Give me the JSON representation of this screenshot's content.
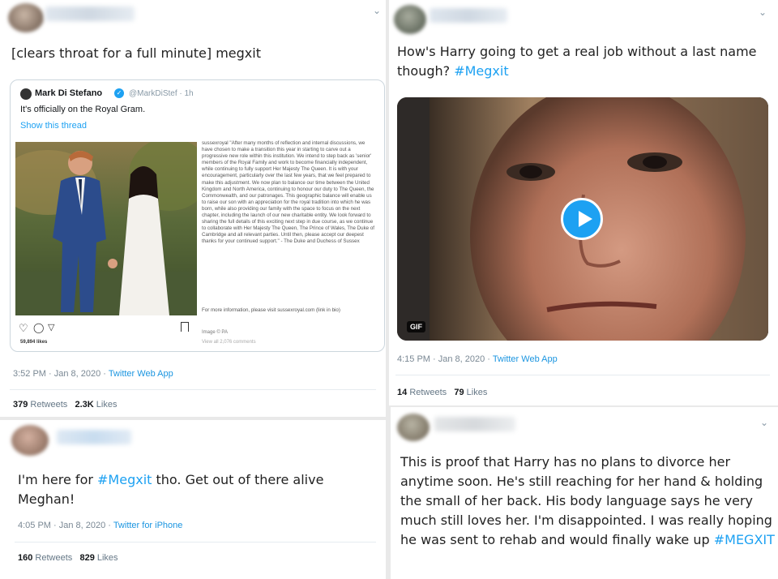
{
  "tweets": [
    {
      "text": "[clears throat for a full minute] megxit",
      "meta": {
        "time": "3:52 PM · Jan 8, 2020 · ",
        "source": "Twitter Web App"
      },
      "stats": {
        "retweets": "379",
        "retweets_label": "Retweets",
        "likes": "2.3K",
        "likes_label": "Likes"
      },
      "embed": {
        "name": "Mark Di Stefano",
        "handle": "@MarkDiStef · 1h",
        "text": "It's officially on the Royal Gram.",
        "link": "Show this thread",
        "caption": "sussexroyal \"After many months of reflection and internal discussions, we have chosen to make a transition this year in starting to carve out a progressive new role within this institution. We intend to step back as 'senior' members of the Royal Family and work to become financially independent, while continuing to fully support Her Majesty The Queen. It is with your encouragement, particularly over the last few years, that we feel prepared to make this adjustment. We now plan to balance our time between the United Kingdom and North America, continuing to honour our duty to The Queen, the Commonwealth, and our patronages. This geographic balance will enable us to raise our son with an appreciation for the royal tradition into which he was born, while also providing our family with the space to focus on the next chapter, including the launch of our new charitable entity. We look forward to sharing the full details of this exciting next step in due course, as we continue to collaborate with Her Majesty The Queen, The Prince of Wales, The Duke of Cambridge and all relevant parties. Until then, please accept our deepest thanks for your continued support.\" - The Duke and Duchess of Sussex",
        "more_info": "For more information, please visit sussexroyal.com (link in bio)",
        "image_credit": "Image © PA",
        "view_comments": "View all 2,076 comments",
        "likes_count": "59,894 likes"
      }
    },
    {
      "text_before": "How's Harry going to get a real job without a last name though? ",
      "hashtag": "#Megxit",
      "meta": {
        "time": "4:15 PM · Jan 8, 2020 · ",
        "source": "Twitter Web App"
      },
      "stats": {
        "retweets": "14",
        "retweets_label": "Retweets",
        "likes": "79",
        "likes_label": "Likes"
      },
      "gif_label": "GIF"
    },
    {
      "text_before": "I'm here for ",
      "hashtag": "#Megxit",
      "text_after": " tho. Get out of there alive Meghan!",
      "meta": {
        "time": "4:05 PM · Jan 8, 2020 · ",
        "source": "Twitter for iPhone"
      },
      "stats": {
        "retweets": "160",
        "retweets_label": "Retweets",
        "likes": "829",
        "likes_label": "Likes"
      }
    },
    {
      "text": "This is proof that Harry has no plans to divorce her anytime soon. He's still reaching for her hand & holding the small of her back. His body language says he very much still loves her. I'm disappointed. I was really hoping he was sent to rehab and would finally wake up ",
      "hashtag": "#MEGXIT"
    }
  ],
  "icons": {
    "caret": "chevron-down-icon",
    "play": "play-icon",
    "verified": "verified-badge-icon"
  },
  "colors": {
    "link": "#1da1f2",
    "background": "#e9e9e9",
    "card": "#ffffff"
  }
}
